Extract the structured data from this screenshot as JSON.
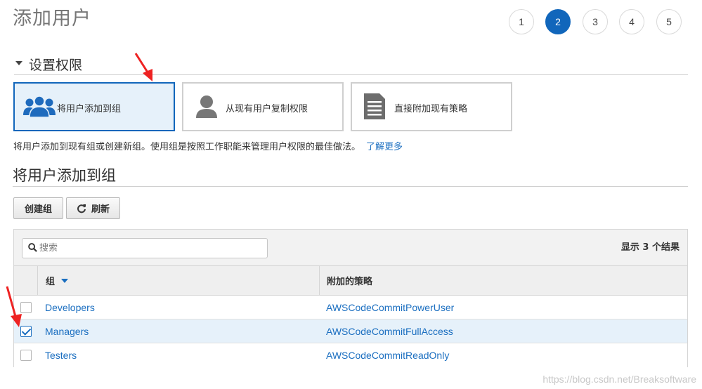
{
  "page": {
    "title": "添加用户"
  },
  "steps": [
    "1",
    "2",
    "3",
    "4",
    "5"
  ],
  "active_step": "2",
  "permissions": {
    "section_title": "设置权限",
    "options": [
      {
        "label": "将用户添加到组",
        "icon": "users-group-icon",
        "selected": true
      },
      {
        "label": "从现有用户复制权限",
        "icon": "user-icon",
        "selected": false
      },
      {
        "label": "直接附加现有策略",
        "icon": "document-icon",
        "selected": false
      }
    ],
    "description": "将用户添加到现有组或创建新组。使用组是按照工作职能来管理用户权限的最佳做法。",
    "learn_more": "了解更多"
  },
  "groups": {
    "title": "将用户添加到组",
    "create_button": "创建组",
    "refresh_button": "刷新",
    "search_placeholder": "搜索",
    "result_count": "显示 3 个结果",
    "columns": {
      "group": "组",
      "policy": "附加的策略"
    },
    "rows": [
      {
        "group": "Developers",
        "policy": "AWSCodeCommitPowerUser",
        "checked": false
      },
      {
        "group": "Managers",
        "policy": "AWSCodeCommitFullAccess",
        "checked": true
      },
      {
        "group": "Testers",
        "policy": "AWSCodeCommitReadOnly",
        "checked": false
      }
    ]
  },
  "colors": {
    "accent": "#1166bb",
    "link": "#1a6ec0",
    "selected_bg": "#e6f1fa",
    "annotation_arrow": "#ee2222"
  },
  "watermark": "https://blog.csdn.net/Breaksoftware"
}
